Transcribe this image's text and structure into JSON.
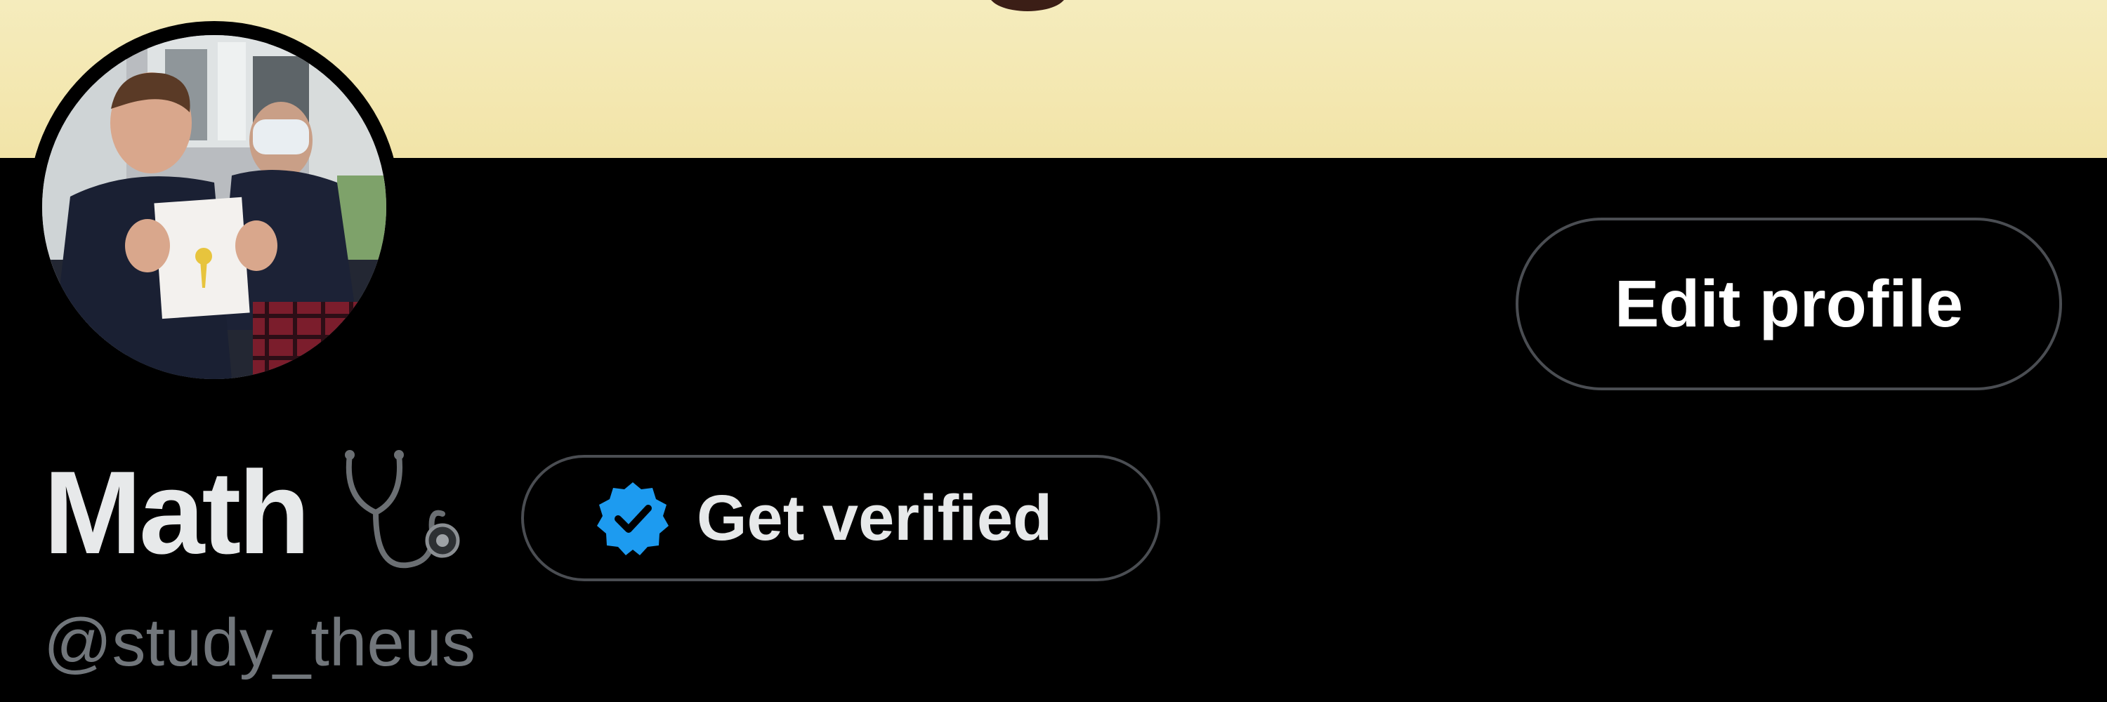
{
  "profile": {
    "display_name": "Math",
    "name_emoji_icon": "stethoscope-icon",
    "handle": "@study_theus",
    "edit_profile_label": "Edit profile",
    "get_verified_label": "Get verified",
    "verified_icon": "verified-badge-icon"
  },
  "colors": {
    "background": "#000000",
    "banner": "#f3e8b2",
    "verified_badge": "#1d9bf0",
    "primary_text": "#e7e9ea",
    "secondary_text": "#71767b",
    "button_border": "#4a4d52"
  }
}
